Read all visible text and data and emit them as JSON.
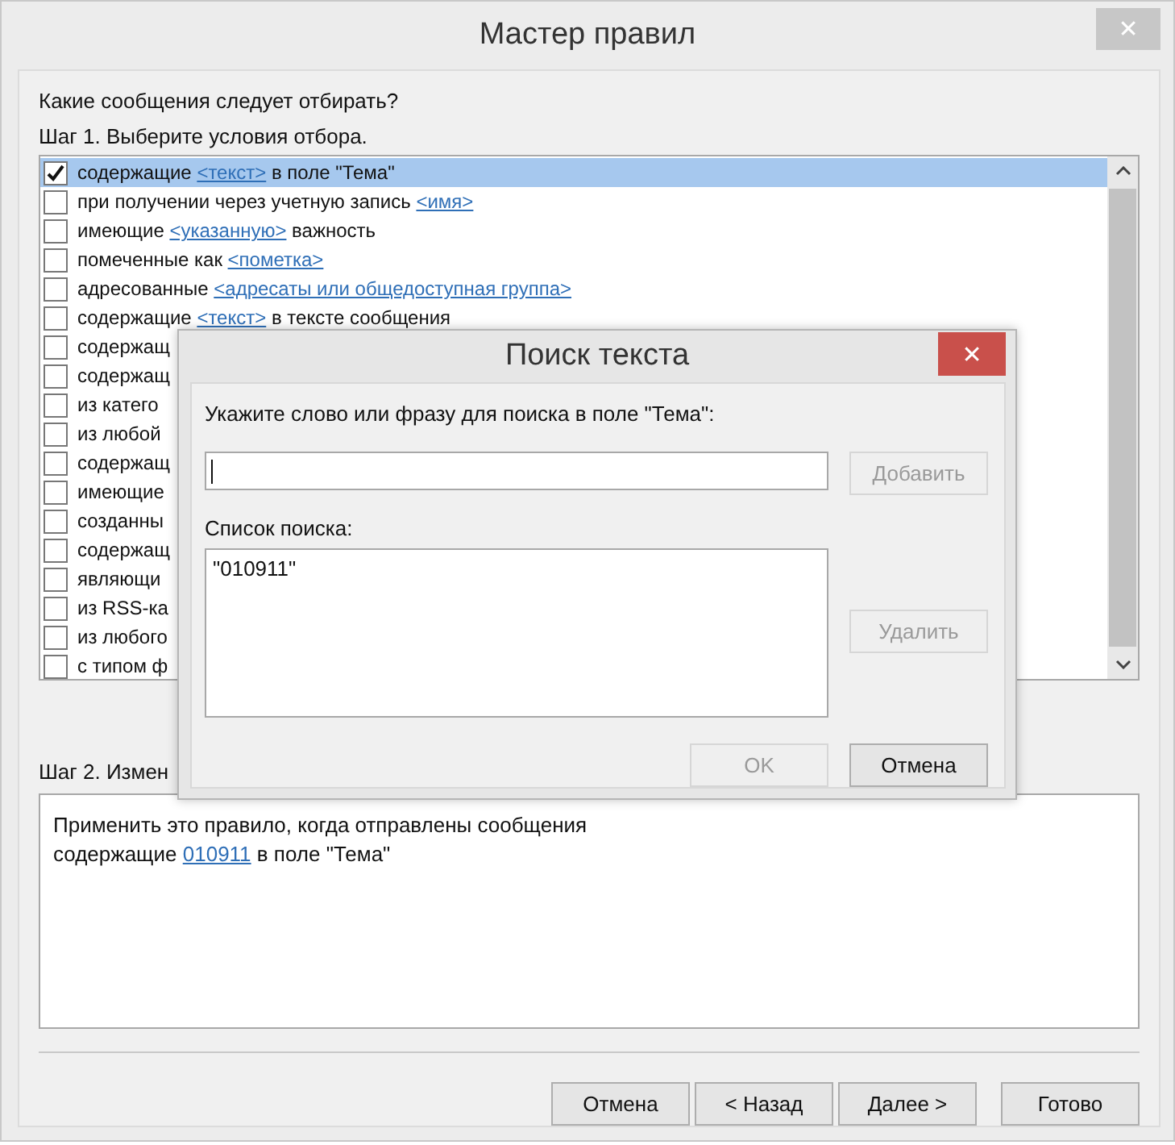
{
  "window": {
    "title": "Мастер правил",
    "close": "✕"
  },
  "question": "Какие сообщения следует отбирать?",
  "step1": "Шаг 1. Выберите условия отбора.",
  "conditions": [
    {
      "checked": true,
      "selected": true,
      "parts": [
        {
          "kind": "text",
          "text": "содержащие "
        },
        {
          "kind": "link",
          "text": "<текст>"
        },
        {
          "kind": "text",
          "text": " в поле \"Тема\""
        }
      ]
    },
    {
      "checked": false,
      "selected": false,
      "parts": [
        {
          "kind": "text",
          "text": "при получении через учетную запись "
        },
        {
          "kind": "link",
          "text": "<имя>"
        }
      ]
    },
    {
      "checked": false,
      "selected": false,
      "parts": [
        {
          "kind": "text",
          "text": "имеющие "
        },
        {
          "kind": "link",
          "text": "<указанную>"
        },
        {
          "kind": "text",
          "text": " важность"
        }
      ]
    },
    {
      "checked": false,
      "selected": false,
      "parts": [
        {
          "kind": "text",
          "text": "помеченные как "
        },
        {
          "kind": "link",
          "text": "<пометка>"
        }
      ]
    },
    {
      "checked": false,
      "selected": false,
      "parts": [
        {
          "kind": "text",
          "text": "адресованные "
        },
        {
          "kind": "link",
          "text": "<адресаты или общедоступная группа>"
        }
      ]
    },
    {
      "checked": false,
      "selected": false,
      "parts": [
        {
          "kind": "text",
          "text": "содержащие "
        },
        {
          "kind": "link",
          "text": "<текст>"
        },
        {
          "kind": "text",
          "text": " в тексте сообщения"
        }
      ]
    },
    {
      "checked": false,
      "selected": false,
      "parts": [
        {
          "kind": "text",
          "text": "содержащ"
        }
      ]
    },
    {
      "checked": false,
      "selected": false,
      "parts": [
        {
          "kind": "text",
          "text": "содержащ"
        }
      ]
    },
    {
      "checked": false,
      "selected": false,
      "parts": [
        {
          "kind": "text",
          "text": "из катего"
        }
      ]
    },
    {
      "checked": false,
      "selected": false,
      "parts": [
        {
          "kind": "text",
          "text": "из любой"
        }
      ]
    },
    {
      "checked": false,
      "selected": false,
      "parts": [
        {
          "kind": "text",
          "text": "содержащ"
        }
      ]
    },
    {
      "checked": false,
      "selected": false,
      "parts": [
        {
          "kind": "text",
          "text": "имеющие"
        }
      ]
    },
    {
      "checked": false,
      "selected": false,
      "parts": [
        {
          "kind": "text",
          "text": "созданны"
        }
      ]
    },
    {
      "checked": false,
      "selected": false,
      "parts": [
        {
          "kind": "text",
          "text": "содержащ"
        }
      ]
    },
    {
      "checked": false,
      "selected": false,
      "parts": [
        {
          "kind": "text",
          "text": "являющи"
        }
      ]
    },
    {
      "checked": false,
      "selected": false,
      "parts": [
        {
          "kind": "text",
          "text": "из RSS-ка"
        }
      ]
    },
    {
      "checked": false,
      "selected": false,
      "parts": [
        {
          "kind": "text",
          "text": "из любого"
        }
      ]
    },
    {
      "checked": false,
      "selected": false,
      "parts": [
        {
          "kind": "text",
          "text": "с типом ф"
        }
      ]
    }
  ],
  "step2": "Шаг 2. Измен",
  "description": [
    [
      {
        "kind": "text",
        "text": "Применить это правило, когда отправлены сообщения"
      }
    ],
    [
      {
        "kind": "text",
        "text": "содержащие "
      },
      {
        "kind": "link",
        "text": "010911"
      },
      {
        "kind": "text",
        "text": " в поле \"Тема\""
      }
    ]
  ],
  "buttons": [
    {
      "label": "Отмена",
      "disabled": false
    },
    {
      "label": "< Назад",
      "disabled": false
    },
    {
      "label": "Далее >",
      "disabled": false
    },
    {
      "label": "Готово",
      "disabled": false
    }
  ],
  "popup": {
    "title": "Поиск текста",
    "close": "✕",
    "prompt": "Укажите слово или фразу для поиска в поле \"Тема\":",
    "add_button": {
      "label": "Добавить",
      "disabled": true
    },
    "list_label": "Список поиска:",
    "list_items": [
      "\"010911\""
    ],
    "remove_button": {
      "label": "Удалить",
      "disabled": true
    },
    "buttons": [
      {
        "label": "OK",
        "disabled": true
      },
      {
        "label": "Отмена",
        "disabled": false
      }
    ]
  }
}
